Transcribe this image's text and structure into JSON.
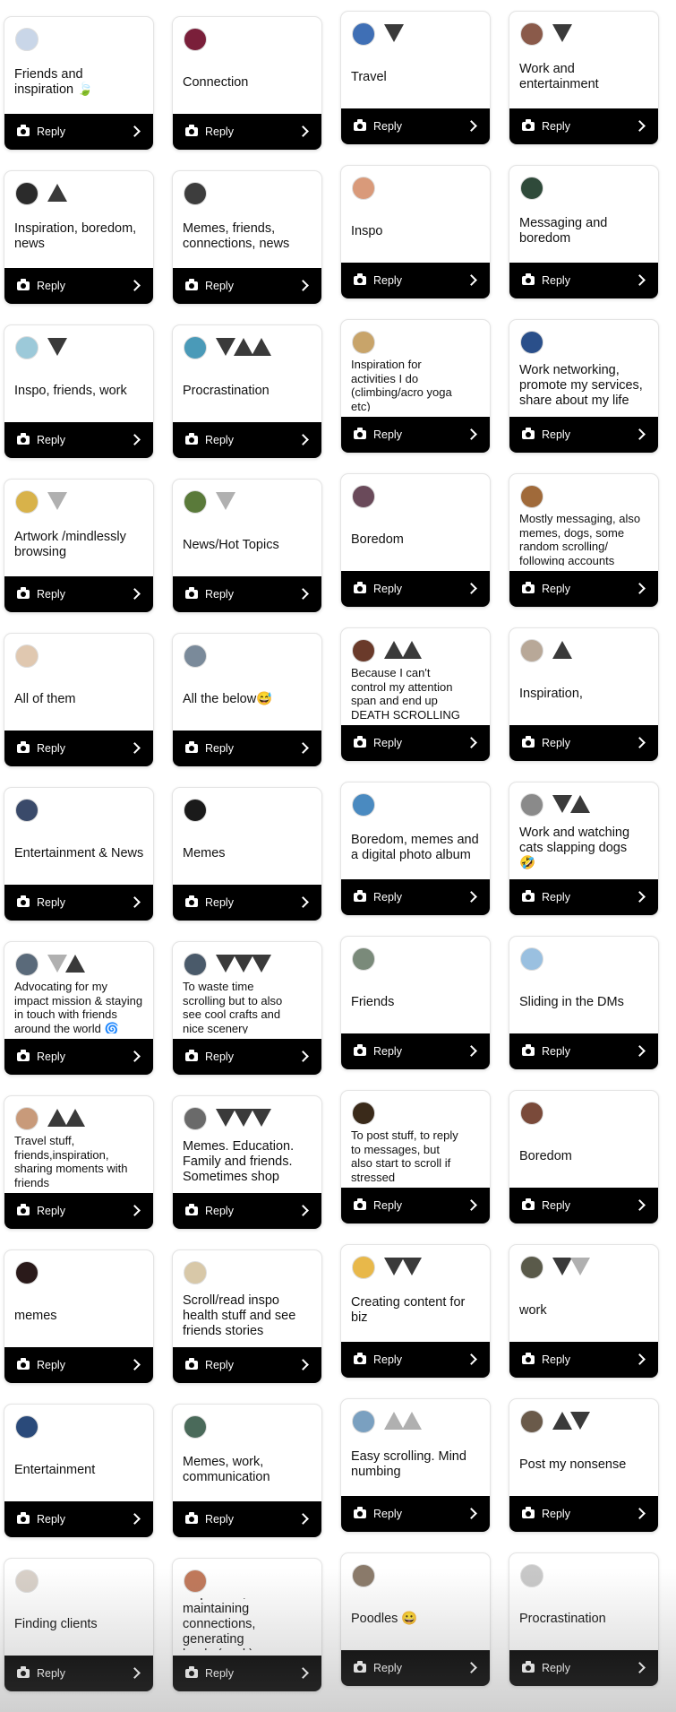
{
  "reply_label": "Reply",
  "cards": [
    {
      "text": "Friends and\ninspiration 🍃",
      "avatar_color": "#c9d6e8",
      "marks": []
    },
    {
      "text": "Connection",
      "avatar_color": "#7a1f3a",
      "marks": []
    },
    {
      "text": "Travel",
      "avatar_color": "#3f6fb5",
      "marks": [
        "down"
      ]
    },
    {
      "text": "Work and\nentertainment",
      "avatar_color": "#8a5a4a",
      "marks": [
        "down"
      ]
    },
    {
      "text": "Inspiration, boredom,\nnews",
      "avatar_color": "#2b2b2b",
      "marks": [
        "up"
      ]
    },
    {
      "text": "Memes, friends,\nconnections, news",
      "avatar_color": "#3d3d3d",
      "marks": []
    },
    {
      "text": "Inspo",
      "avatar_color": "#d99a7a",
      "marks": []
    },
    {
      "text": "Messaging and\nboredom",
      "avatar_color": "#2f4a3a",
      "marks": []
    },
    {
      "text": "Inspo, friends, work",
      "avatar_color": "#9cc9d9",
      "marks": [
        "down"
      ]
    },
    {
      "text": "Procrastination",
      "avatar_color": "#4a9ab8",
      "marks": [
        "down",
        "up",
        "up"
      ]
    },
    {
      "text": "Inspiration for\nactivities I do\n(climbing/acro yoga\netc)",
      "avatar_color": "#c8a46a",
      "marks": []
    },
    {
      "text": "Work networking,\npromote my services,\nshare about my life",
      "avatar_color": "#2a4f8a",
      "marks": []
    },
    {
      "text": "Artwork /mindlessly\nbrowsing",
      "avatar_color": "#d8b24a",
      "marks": [
        "greydown"
      ]
    },
    {
      "text": "News/Hot Topics",
      "avatar_color": "#5a7a3a",
      "marks": [
        "greydown"
      ]
    },
    {
      "text": "Boredom",
      "avatar_color": "#6a4a5a",
      "marks": []
    },
    {
      "text": "Mostly messaging, also\nmemes, dogs, some\nrandom scrolling/\nfollowing accounts",
      "avatar_color": "#a06a3a",
      "marks": []
    },
    {
      "text": "All of them",
      "avatar_color": "#e0c8b0",
      "marks": []
    },
    {
      "text": "All the below😅",
      "avatar_color": "#7a8a9a",
      "marks": []
    },
    {
      "text": "Because I can't\ncontrol my attention\nspan and end up\nDEATH SCROLLING",
      "avatar_color": "#6a3a2a",
      "marks": [
        "up",
        "up"
      ]
    },
    {
      "text": "Inspiration,",
      "avatar_color": "#b8a898",
      "marks": [
        "up"
      ]
    },
    {
      "text": "Entertainment & News",
      "avatar_color": "#3a4a6a",
      "marks": []
    },
    {
      "text": "Memes",
      "avatar_color": "#1a1a1a",
      "marks": []
    },
    {
      "text": "Boredom, memes and\na digital photo album",
      "avatar_color": "#4a8ac0",
      "marks": []
    },
    {
      "text": "Work and watching\ncats slapping dogs\n🤣",
      "avatar_color": "#8a8a8a",
      "marks": [
        "down",
        "up"
      ]
    },
    {
      "text": "Advocating for my\nimpact mission & staying\nin touch with friends\naround the world 🌀",
      "avatar_color": "#5a6a7a",
      "marks": [
        "greydown",
        "up"
      ]
    },
    {
      "text": "To waste time\nscrolling but to also\nsee cool crafts and\nnice scenery",
      "avatar_color": "#4a5a6a",
      "marks": [
        "down",
        "down",
        "down"
      ]
    },
    {
      "text": "Friends",
      "avatar_color": "#7a8a7a",
      "marks": []
    },
    {
      "text": "Sliding in the DMs",
      "avatar_color": "#9ac0e0",
      "marks": []
    },
    {
      "text": "Travel stuff,\nfriends,inspiration,\nsharing moments with\nfriends",
      "avatar_color": "#c89a7a",
      "marks": [
        "up",
        "up"
      ]
    },
    {
      "text": "Memes. Education.\nFamily and friends.\nSometimes shop",
      "avatar_color": "#6a6a6a",
      "marks": [
        "down",
        "down",
        "down"
      ]
    },
    {
      "text": "To post stuff, to reply\nto messages, but\nalso start to scroll if\nstressed",
      "avatar_color": "#3a2a1a",
      "marks": []
    },
    {
      "text": "Boredom",
      "avatar_color": "#7a4a3a",
      "marks": []
    },
    {
      "text": "memes",
      "avatar_color": "#2a1a1a",
      "marks": []
    },
    {
      "text": "Scroll/read inspo\nhealth stuff and see\nfriends stories",
      "avatar_color": "#d8c8a8",
      "marks": []
    },
    {
      "text": "Creating content for\nbiz",
      "avatar_color": "#e8b84a",
      "marks": [
        "down",
        "down"
      ]
    },
    {
      "text": "work",
      "avatar_color": "#5a5a4a",
      "marks": [
        "down",
        "greydown"
      ]
    },
    {
      "text": "Entertainment",
      "avatar_color": "#2a4a7a",
      "marks": []
    },
    {
      "text": "Memes, work,\ncommunication",
      "avatar_color": "#4a6a5a",
      "marks": []
    },
    {
      "text": "Easy scrolling. Mind\nnumbing",
      "avatar_color": "#7aa0c0",
      "marks": [
        "greyup",
        "greyup"
      ]
    },
    {
      "text": "Post my nonsense",
      "avatar_color": "#6a5a4a",
      "marks": [
        "up",
        "down"
      ]
    },
    {
      "text": "Finding clients",
      "avatar_color": "#d8d0c8",
      "marks": []
    },
    {
      "text": "Inspiration, maintaining\nconnections, generating\nleads (work)",
      "avatar_color": "#c0785a",
      "marks": []
    },
    {
      "text": "Poodles 😀",
      "avatar_color": "#8a7a6a",
      "marks": []
    },
    {
      "text": "Procrastination",
      "avatar_color": "#c8c8c8",
      "marks": []
    }
  ]
}
